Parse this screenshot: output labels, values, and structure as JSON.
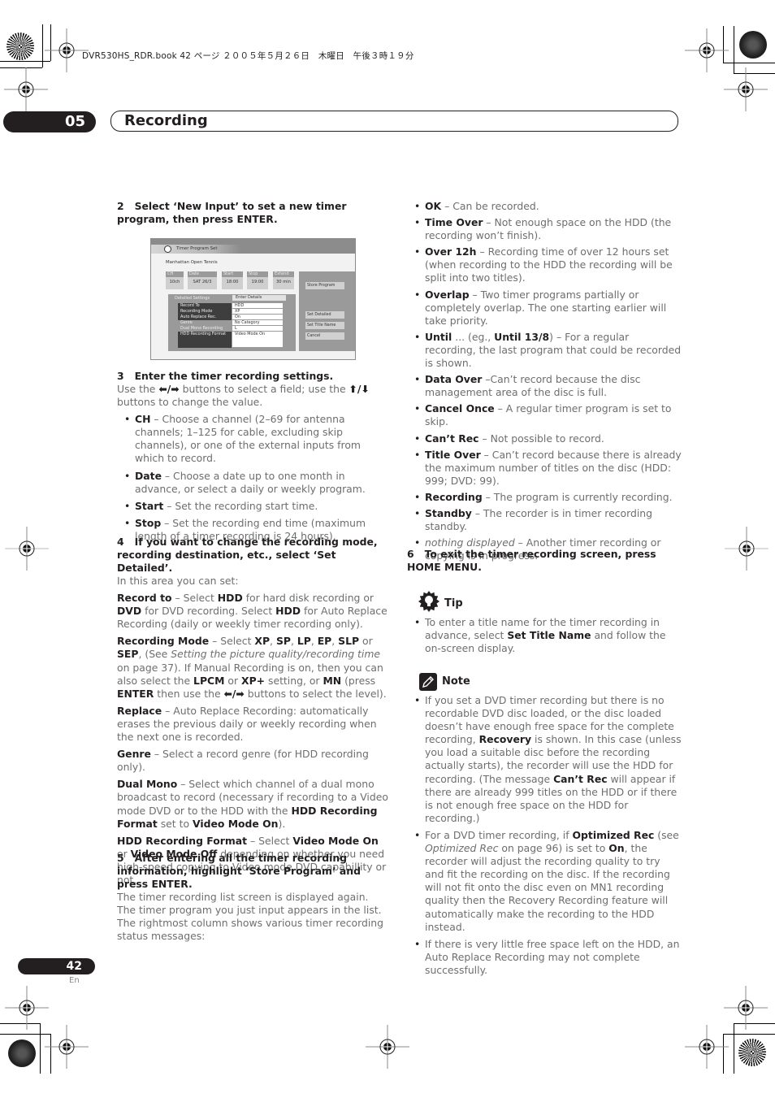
{
  "print_header": {
    "text": "DVR530HS_RDR.book  42 ページ  ２００５年５月２６日　木曜日　午後３時１９分"
  },
  "chapter": {
    "number": "05",
    "title": "Recording"
  },
  "left_column": {
    "step2": {
      "num": "2",
      "text": "Select ‘New Input’ to set a new timer program, then press ENTER."
    },
    "screenshot": {
      "title": "Timer Program Set",
      "program_name": "Manhattan Open Tennis",
      "fields": [
        {
          "label": "CH",
          "value": "10ch"
        },
        {
          "label": "Date",
          "value": "SAT 26/3"
        },
        {
          "label": "Start",
          "value": "18:00"
        },
        {
          "label": "Stop",
          "value": "19:00"
        },
        {
          "label": "Extend",
          "value": "30 min"
        }
      ],
      "detail_header_left": "Detailed Settings",
      "detail_header_right": "Enter Details",
      "detail_rows": [
        {
          "key": "Record To",
          "value": "HDD"
        },
        {
          "key": "Recording Mode",
          "value": "XP"
        },
        {
          "key": "Auto Replace Rec.",
          "value": "On"
        },
        {
          "key": "Genre",
          "value": "No Category"
        },
        {
          "key": "Dual Mono Recording",
          "value": "L"
        },
        {
          "key": "HDD Recording Format",
          "value": "Video Mode On"
        }
      ],
      "buttons": {
        "store_program": "Store Program",
        "set_detailed": "Set Detailed",
        "set_title_name": "Set Title Name",
        "cancel": "Cancel"
      }
    },
    "step3": {
      "num": "3",
      "head": "Enter the timer recording settings.",
      "body_pre": "Use the ",
      "lr_arrows": "⬅/➡",
      "body_mid": " buttons to select a field; use the ",
      "ud_arrows": "⬆/⬇",
      "body_post": " buttons to change the value.",
      "bullets": [
        {
          "term": "CH",
          "text": " – Choose a channel (2–69 for antenna channels; 1–125 for cable, excluding skip channels), or one of the external inputs from which to record."
        },
        {
          "term": "Date",
          "text": " – Choose a date up to one month in advance, or select a daily or weekly program."
        },
        {
          "term": "Start",
          "text": " – Set the recording start time."
        },
        {
          "term": "Stop",
          "text": " – Set the recording end time (maximum length of a timer recording is 24 hours)."
        }
      ]
    },
    "step4": {
      "num": "4",
      "head": "If you want to change the recording mode, recording destination, etc., select ‘Set Detailed’.",
      "intro": "In this area you can set:",
      "record_to": {
        "term": "Record to",
        "t1": " – Select ",
        "b1": "HDD",
        "t2": " for hard disk recording or ",
        "b2": "DVD",
        "t3": " for DVD recording. Select ",
        "b3": "HDD",
        "t4": "  for Auto Replace Recording (daily or weekly timer recording only)."
      },
      "recording_mode": {
        "term": "Recording Mode",
        "t1": " – Select ",
        "modes": [
          "XP",
          "SP",
          "LP",
          "EP",
          "SLP",
          "SEP"
        ],
        "see_pre": ", (See ",
        "see_italic": "Setting the picture quality/recording time",
        "see_post": " on page 37). If Manual Recording is on, then you can also select the ",
        "b_lpcm": "LPCM",
        "or1": " or ",
        "b_xpplus": "XP+",
        "t_setting": " setting, or ",
        "b_mn": "MN",
        "t_press": " (press ",
        "b_enter": "ENTER",
        "t_then": " then use the ",
        "arrows": "⬅/➡",
        "t_end": " buttons to select the level)."
      },
      "replace": {
        "term": "Replace",
        "text": " – Auto Replace Recording: automatically erases the previous daily or weekly recording when the next one is recorded."
      },
      "genre": {
        "term": "Genre",
        "text": " – Select a record genre (for HDD recording only)."
      },
      "dual_mono": {
        "term": "Dual Mono",
        "t1": " – Select which channel of a dual mono broadcast to record (necessary if recording to a Video mode DVD or to the HDD with the ",
        "b1": "HDD Recording Format",
        "t2": " set to ",
        "b2": "Video Mode On",
        "t3": ")."
      },
      "hdd_format": {
        "term": "HDD Recording Format",
        "t1": " – Select ",
        "b1": "Video Mode On",
        "t2": " or ",
        "b2": "Video Mode Off",
        "t3": " depending on whether you need high-speed copying to Video mode DVD capabillity or not."
      }
    },
    "step5": {
      "num": "5",
      "head": "After entering all the timer recording information, highlight ‘Store Program’ and press ENTER.",
      "body": "The timer recording list screen is displayed again. The timer program you just input appears in the list. The rightmost column shows various timer recording status messages:"
    }
  },
  "right_column": {
    "status_bullets": [
      {
        "term": "OK",
        "text": " – Can be recorded."
      },
      {
        "term": "Time Over",
        "text": " – Not enough space on the HDD (the recording won’t finish)."
      },
      {
        "term": "Over 12h",
        "text": " – Recording time of over 12 hours set (when recording to the HDD the recording will be split into two titles)."
      },
      {
        "term": "Overlap",
        "text": " – Two timer programs partially or completely overlap. The one starting earlier will take priority."
      },
      {
        "term": "Until",
        "text": " ... (eg., ",
        "term2": "Until 13/8",
        "text2": ") – For a regular recording, the last program that could be recorded is shown."
      },
      {
        "term": "Data Over",
        "text": " –Can’t record because the disc management area of the disc is full."
      },
      {
        "term": "Cancel Once",
        "text": " – A regular timer program is set to skip."
      },
      {
        "term": "Can’t Rec",
        "text": " – Not possible to record."
      },
      {
        "term": "Title Over",
        "text": " – Can’t record because there is already the maximum number of titles on the disc (HDD: 999; DVD: 99)."
      },
      {
        "term": "Recording",
        "text": " – The program is currently recording."
      },
      {
        "term": "Standby",
        "text": " – The recorder is in timer recording standby."
      },
      {
        "term_italic": "nothing displayed",
        "text": " – Another timer recording or copying is in progress."
      }
    ],
    "step6": {
      "num": "6",
      "head": "To exit the timer recording screen, press HOME MENU."
    },
    "tip": {
      "title": "Tip",
      "t1": "To enter a title name for the timer recording in advance, select ",
      "b1": "Set Title Name",
      "t2": " and follow the on-screen display."
    },
    "note": {
      "title": "Note",
      "items": [
        {
          "t1": "If you set a DVD timer recording but there is no recordable DVD disc loaded, or the disc loaded doesn’t have enough free space for the complete recording, ",
          "b1": "Recovery",
          "t2": " is shown. In this case (unless you load a suitable disc before the recording actually starts), the recorder will use the HDD for recording. (The message ",
          "b2": "Can’t Rec",
          "t3": " will appear if there are already 999 titles on the HDD or if there is not enough free space on the HDD for recording.)"
        },
        {
          "t1": "For a DVD timer recording, if ",
          "b1": "Optimized Rec",
          "t2": " (see ",
          "i1": "Optimized Rec",
          "t3": " on page 96) is set to ",
          "b2": "On",
          "t4": ", the recorder will adjust the recording quality to try and fit the recording on the disc. If the recording will not fit onto the disc even on MN1 recording quality then the Recovery Recording feature will automatically make the recording to the HDD instead."
        },
        {
          "t1": "If there is very little free space left on the HDD, an Auto Replace Recording may not complete successfully."
        }
      ]
    }
  },
  "footer": {
    "page_number": "42",
    "language": "En"
  }
}
